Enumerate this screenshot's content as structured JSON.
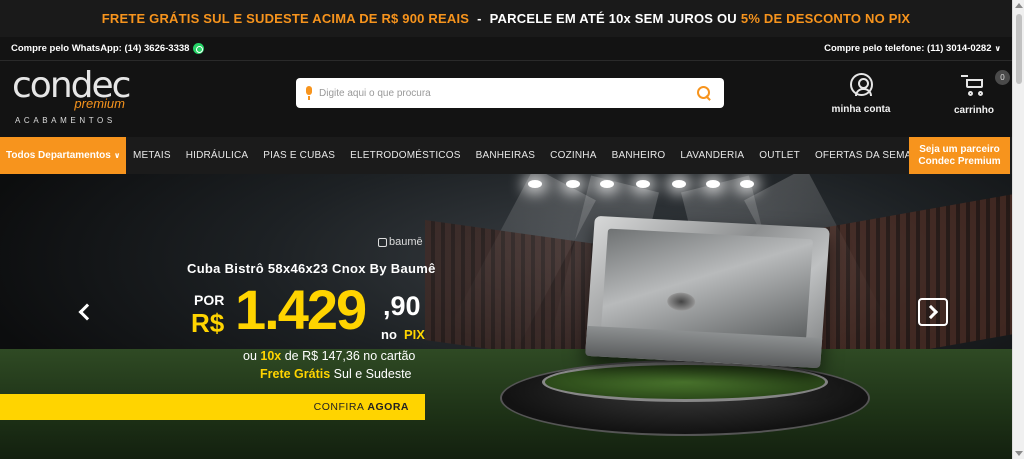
{
  "promo": {
    "part1": "FRETE GRÁTIS SUL E SUDESTE ACIMA DE R$ 900 REAIS",
    "separator": "-",
    "part2": "PARCELE EM ATÉ 10x SEM JUROS OU",
    "part3": "5% DE DESCONTO NO PIX",
    "accent_color": "#f7941d"
  },
  "contact": {
    "whatsapp": "Compre pelo WhatsApp: (14) 3626-3338",
    "phone": "Compre pelo telefone: (11) 3014-0282",
    "phone_chevron": "∨"
  },
  "header": {
    "logo_word": "condec",
    "logo_sub": "premium",
    "logo_tagline": "ACABAMENTOS",
    "search_placeholder": "Digite aqui o que procura",
    "account_label": "minha conta",
    "cart_label": "carrinho",
    "cart_count": "0"
  },
  "nav": {
    "departments": "Todos Departamentos",
    "departments_chevron": "∨",
    "items": [
      "METAIS",
      "HIDRÁULICA",
      "PIAS E CUBAS",
      "ELETRODOMÉSTICOS",
      "BANHEIRAS",
      "COZINHA",
      "BANHEIRO",
      "LAVANDERIA",
      "OUTLET",
      "OFERTAS DA SEMANA"
    ],
    "partner_line1": "Seja um parceiro",
    "partner_line2": "Condec Premium"
  },
  "hero": {
    "brand": "baumē",
    "title": "Cuba Bistrô 58x46x23 Cnox By Baumê",
    "por": "POR",
    "currency": "R$",
    "price_int": "1.429",
    "price_dec": ",90",
    "no": "no",
    "pix": "PIX",
    "install_prefix": "ou",
    "install_count": "10x",
    "install_rest": "de R$ 147,36 no cartão",
    "ship_bold": "Frete Grátis",
    "ship_rest": "Sul e Sudeste",
    "cta_1": "CONFIRA",
    "cta_2": "AGORA",
    "price_color": "#ffd400"
  }
}
